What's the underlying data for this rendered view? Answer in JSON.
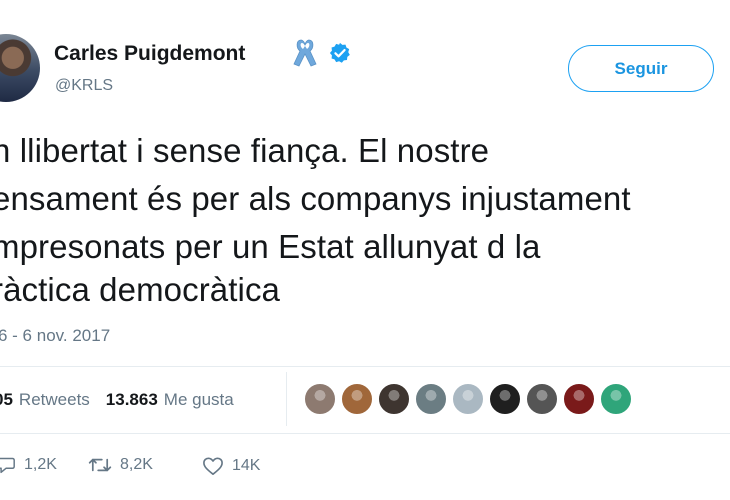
{
  "header": {
    "name": "Carles Puigdemont",
    "handle": "@KRLS",
    "follow_label": "Seguir"
  },
  "tweet": {
    "lines": [
      "n llibertat i sense fiança. El nostre",
      "ensament és per als companys injustament",
      "mpresonats per un Estat allunyat d la",
      "ràctica democràtica"
    ],
    "timestamp": "6 - 6 nov. 2017"
  },
  "stats": {
    "retweets_count": "05",
    "retweets_label": "Retweets",
    "likes_count": "13.863",
    "likes_label": "Me gusta"
  },
  "likers": [
    {
      "name": "liker-1",
      "color": "#8d7a70"
    },
    {
      "name": "liker-2",
      "color": "#a0673a"
    },
    {
      "name": "liker-3",
      "color": "#3e3530"
    },
    {
      "name": "liker-4",
      "color": "#6b7d83"
    },
    {
      "name": "liker-5",
      "color": "#aab8c2"
    },
    {
      "name": "liker-6",
      "color": "#1f1f1f"
    },
    {
      "name": "liker-7",
      "color": "#555555"
    },
    {
      "name": "liker-8",
      "color": "#7a1a1a"
    },
    {
      "name": "liker-9",
      "color": "#2fa57a"
    }
  ],
  "actions": {
    "replies": "1,2K",
    "retweets": "8,2K",
    "likes": "14K"
  },
  "colors": {
    "accent": "#1da1f2",
    "verified": "#1da1f2",
    "ribbon": "#6fa8dc",
    "muted": "#657786"
  }
}
